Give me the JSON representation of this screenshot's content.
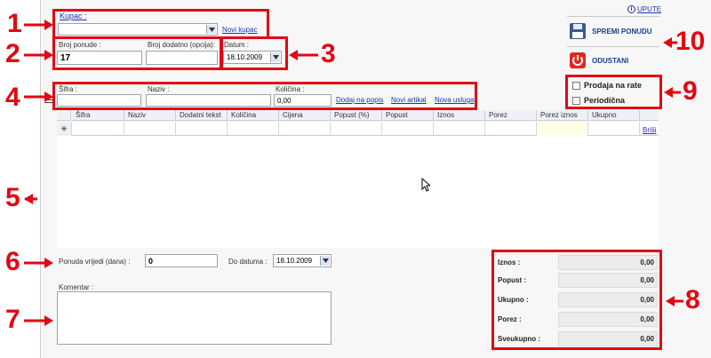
{
  "header": {
    "help_link": "UPUTE"
  },
  "customer": {
    "label": "Kupac :",
    "value": "",
    "new_link": "Novi kupac"
  },
  "offer": {
    "number_label": "Broj ponude :",
    "number_value": "17",
    "extra_label": "Broj dodatno (opcija):",
    "extra_value": "",
    "date_label": "Datum :",
    "date_value": "18.10.2009"
  },
  "item_entry": {
    "code_label": "Šifra :",
    "name_label": "Naziv :",
    "qty_label": "Količina :",
    "qty_value": "0,00",
    "add_link": "Dodaj na popis",
    "new_article_link": "Novi artikal",
    "new_service_link": "Nova usluga"
  },
  "grid": {
    "columns": [
      "Šifra",
      "Naziv",
      "Dodatni tekst",
      "Količina",
      "Cijena",
      "Popust (%)",
      "Popust",
      "Iznos",
      "Porez",
      "Porez iznos",
      "Ukupno"
    ],
    "new_row_marker": "✳",
    "delete_link": "Briši"
  },
  "validity": {
    "label": "Ponuda vrijedi (dana) :",
    "value": "0",
    "until_label": "Do datuma :",
    "until_value": "18.10.2009"
  },
  "comment": {
    "label": "Komentar :",
    "value": ""
  },
  "summary": {
    "rows": [
      {
        "label": "Iznos :",
        "value": "0,00"
      },
      {
        "label": "Popust :",
        "value": "0,00"
      },
      {
        "label": "Ukupno :",
        "value": "0,00"
      },
      {
        "label": "Porez :",
        "value": "0,00"
      },
      {
        "label": "Sveukupno :",
        "value": "0,00"
      }
    ]
  },
  "actions": {
    "save_label": "SPREMI PONUDU",
    "cancel_label": "ODUSTANI"
  },
  "options": {
    "installments_label": "Prodaja na rate",
    "periodic_label": "Periodična",
    "installments_checked": false,
    "periodic_checked": false
  },
  "callouts": [
    "1",
    "2",
    "3",
    "4",
    "5",
    "6",
    "7",
    "8",
    "9",
    "10"
  ],
  "colors": {
    "annotation": "#e30613",
    "link": "#1a35b0",
    "button_text": "#1a3e8c",
    "panel": "#f7f7f7"
  }
}
